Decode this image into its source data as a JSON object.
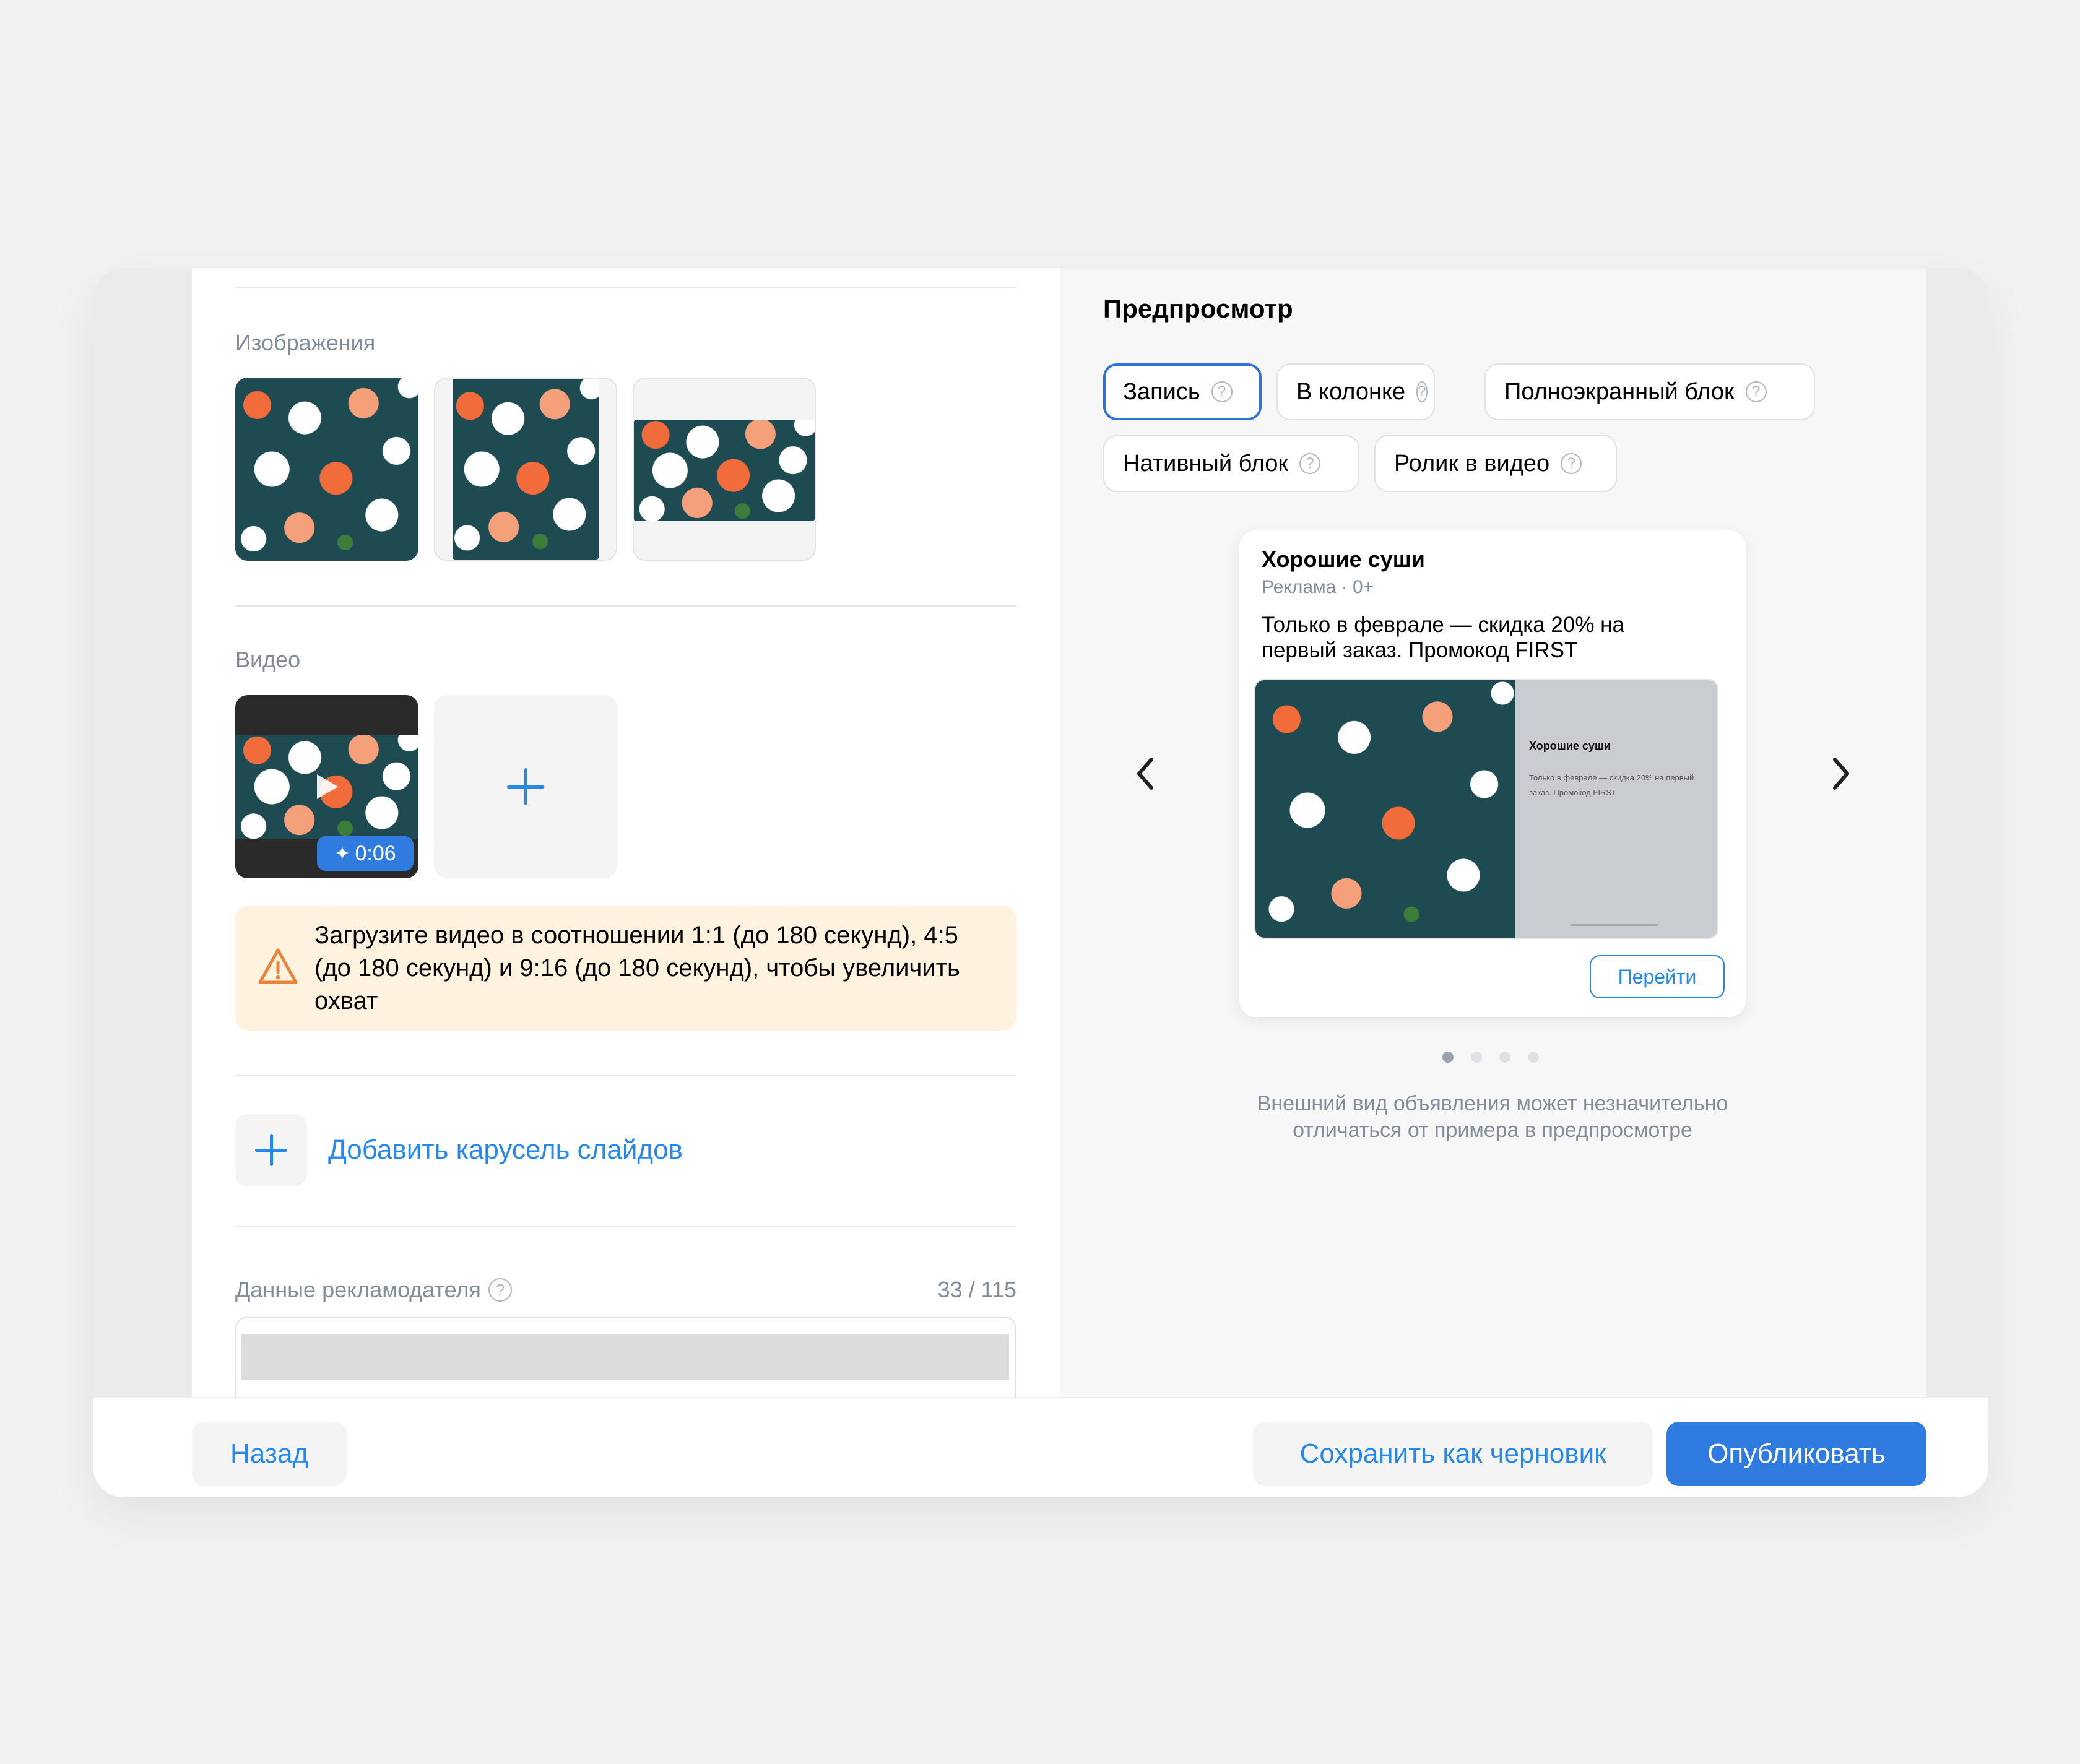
{
  "images_section": {
    "label": "Изображения"
  },
  "video_section": {
    "label": "Видео",
    "duration": "0:06",
    "warning_text": "Загрузите видео в соотношении 1:1 (до 180 секунд), 4:5 (до 180 секунд) и 9:16 (до 180 секунд), чтобы увеличить охват"
  },
  "carousel": {
    "add_label": "Добавить карусель слайдов"
  },
  "advertiser": {
    "label": "Данные рекламодателя",
    "counter": "33 / 115"
  },
  "preview": {
    "title": "Предпросмотр",
    "chips": [
      {
        "label": "Запись",
        "active": true
      },
      {
        "label": "В колонке",
        "active": false
      },
      {
        "label": "Полноэкранный блок",
        "active": false
      },
      {
        "label": "Нативный блок",
        "active": false
      },
      {
        "label": "Ролик в видео",
        "active": false
      }
    ],
    "ad": {
      "title": "Хорошие суши",
      "meta": "Реклама · 0+",
      "text": "Только в феврале — скидка 20% на первый заказ. Промокод FIRST",
      "banner_title": "Хорошие суши",
      "banner_text": "Только в феврале — скидка 20% на первый заказ. Промокод FIRST",
      "button": "Перейти"
    },
    "slides_total": 4,
    "slide_active": 1,
    "disclaimer_line1": "Внешний вид объявления может незначительно",
    "disclaimer_line2": "отличаться от примера в предпросмотре"
  },
  "footer": {
    "back": "Назад",
    "save_draft": "Сохранить как черновик",
    "publish": "Опубликовать"
  },
  "colors": {
    "accent": "#2688eb",
    "primary_button": "#2f7be0",
    "warning_bg": "#fff3e0",
    "warning_icon": "#e8853a"
  }
}
